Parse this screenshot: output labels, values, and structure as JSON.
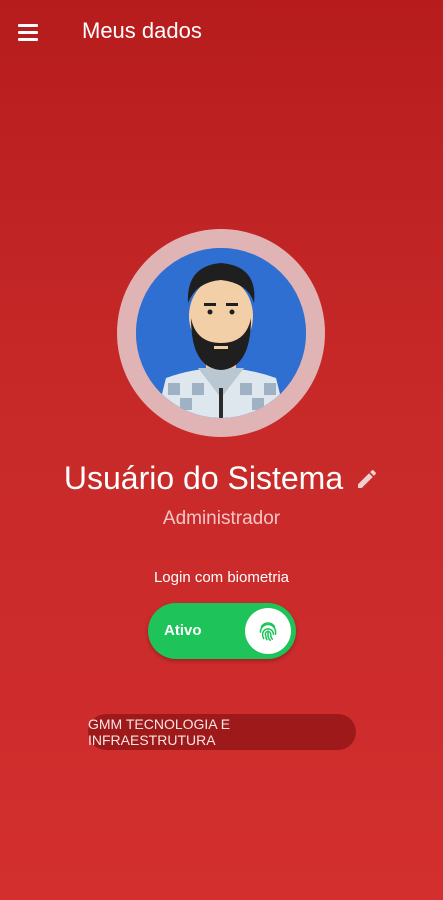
{
  "header": {
    "title": "Meus dados",
    "menu_icon": "hamburger-menu-icon"
  },
  "profile": {
    "name": "Usuário do Sistema",
    "role": "Administrador",
    "avatar_icon": "bearded-man-avatar",
    "edit_icon": "pencil-icon"
  },
  "biometrics": {
    "label": "Login com biometria",
    "status": "Ativo",
    "enabled": true,
    "icon": "fingerprint-icon"
  },
  "company": {
    "name": "GMM TECNOLOGIA E INFRAESTRUTURA"
  },
  "colors": {
    "background_top": "#b71c1c",
    "background_bottom": "#d32f2f",
    "toggle_active": "#1ec45a",
    "avatar_bg": "#2f6fd1",
    "company_pill": "#9e1a1a"
  }
}
